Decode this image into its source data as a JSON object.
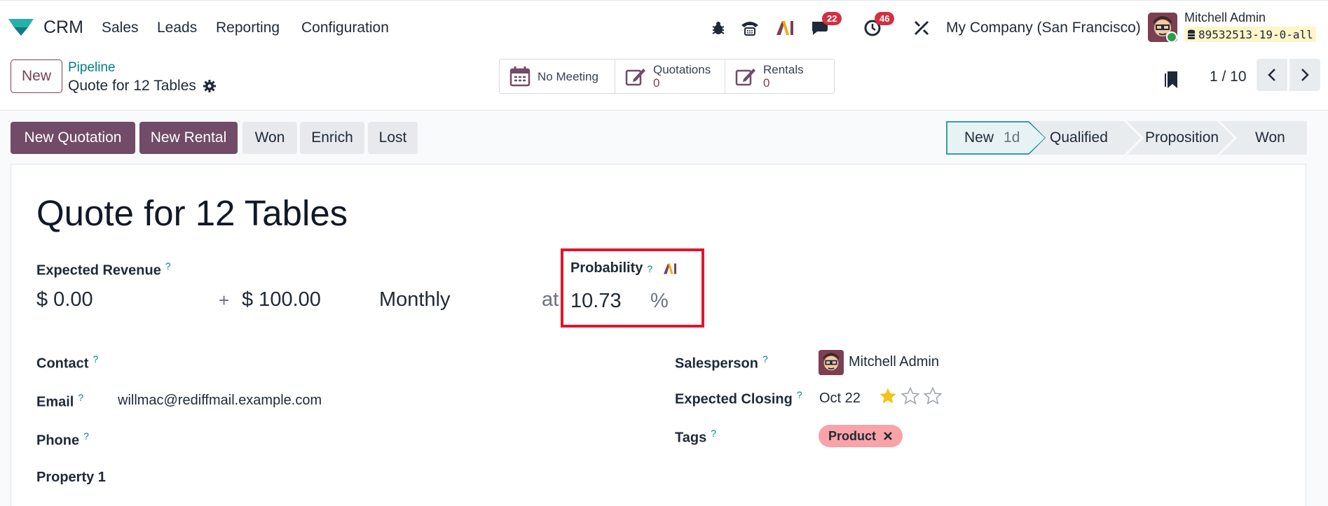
{
  "navbar": {
    "app_name": "CRM",
    "menu": [
      "Sales",
      "Leads",
      "Reporting",
      "Configuration"
    ],
    "messages_badge": "22",
    "activities_badge": "46",
    "company": "My Company (San Francisco)",
    "user_name": "Mitchell Admin",
    "database": "89532513-19-0-all",
    "icons": [
      "bug-icon",
      "phone-icon",
      "ai-icon",
      "chat-icon",
      "clock-icon",
      "tools-icon"
    ]
  },
  "control": {
    "new_label": "New",
    "breadcrumb": "Pipeline",
    "record_title": "Quote for 12 Tables",
    "smart_buttons": [
      {
        "label": "No Meeting",
        "count": ""
      },
      {
        "label": "Quotations",
        "count": "0"
      },
      {
        "label": "Rentals",
        "count": "0"
      }
    ],
    "pager": "1 / 10"
  },
  "actions": {
    "new_quotation": "New Quotation",
    "new_rental": "New Rental",
    "won": "Won",
    "enrich": "Enrich",
    "lost": "Lost"
  },
  "stages": {
    "items": [
      {
        "label": "New",
        "days": "1d",
        "active": true
      },
      {
        "label": "Qualified",
        "days": "",
        "active": false
      },
      {
        "label": "Proposition",
        "days": "",
        "active": false
      },
      {
        "label": "Won",
        "days": "",
        "active": false
      }
    ]
  },
  "form": {
    "title": "Quote for 12 Tables",
    "expected_revenue_label": "Expected Revenue",
    "expected_revenue": "$ 0.00",
    "plus": "+",
    "recurring_revenue": "$ 100.00",
    "recurring_plan": "Monthly",
    "at": "at",
    "probability_label": "Probability",
    "probability": "10.73",
    "percent": "%",
    "help": "?",
    "contact_label": "Contact",
    "email_label": "Email",
    "email": "willmac@rediffmail.example.com",
    "phone_label": "Phone",
    "property_label": "Property 1",
    "salesperson_label": "Salesperson",
    "salesperson": "Mitchell Admin",
    "expected_closing_label": "Expected Closing",
    "expected_closing": "Oct 22",
    "priority_stars": 1,
    "tags_label": "Tags",
    "tag": "Product"
  },
  "colors": {
    "brand": "#714b67",
    "teal": "#017e84",
    "badge": "#d3303f",
    "highlight": "#e0162b",
    "tag": "#f8a3a8",
    "star": "#f3c316"
  }
}
